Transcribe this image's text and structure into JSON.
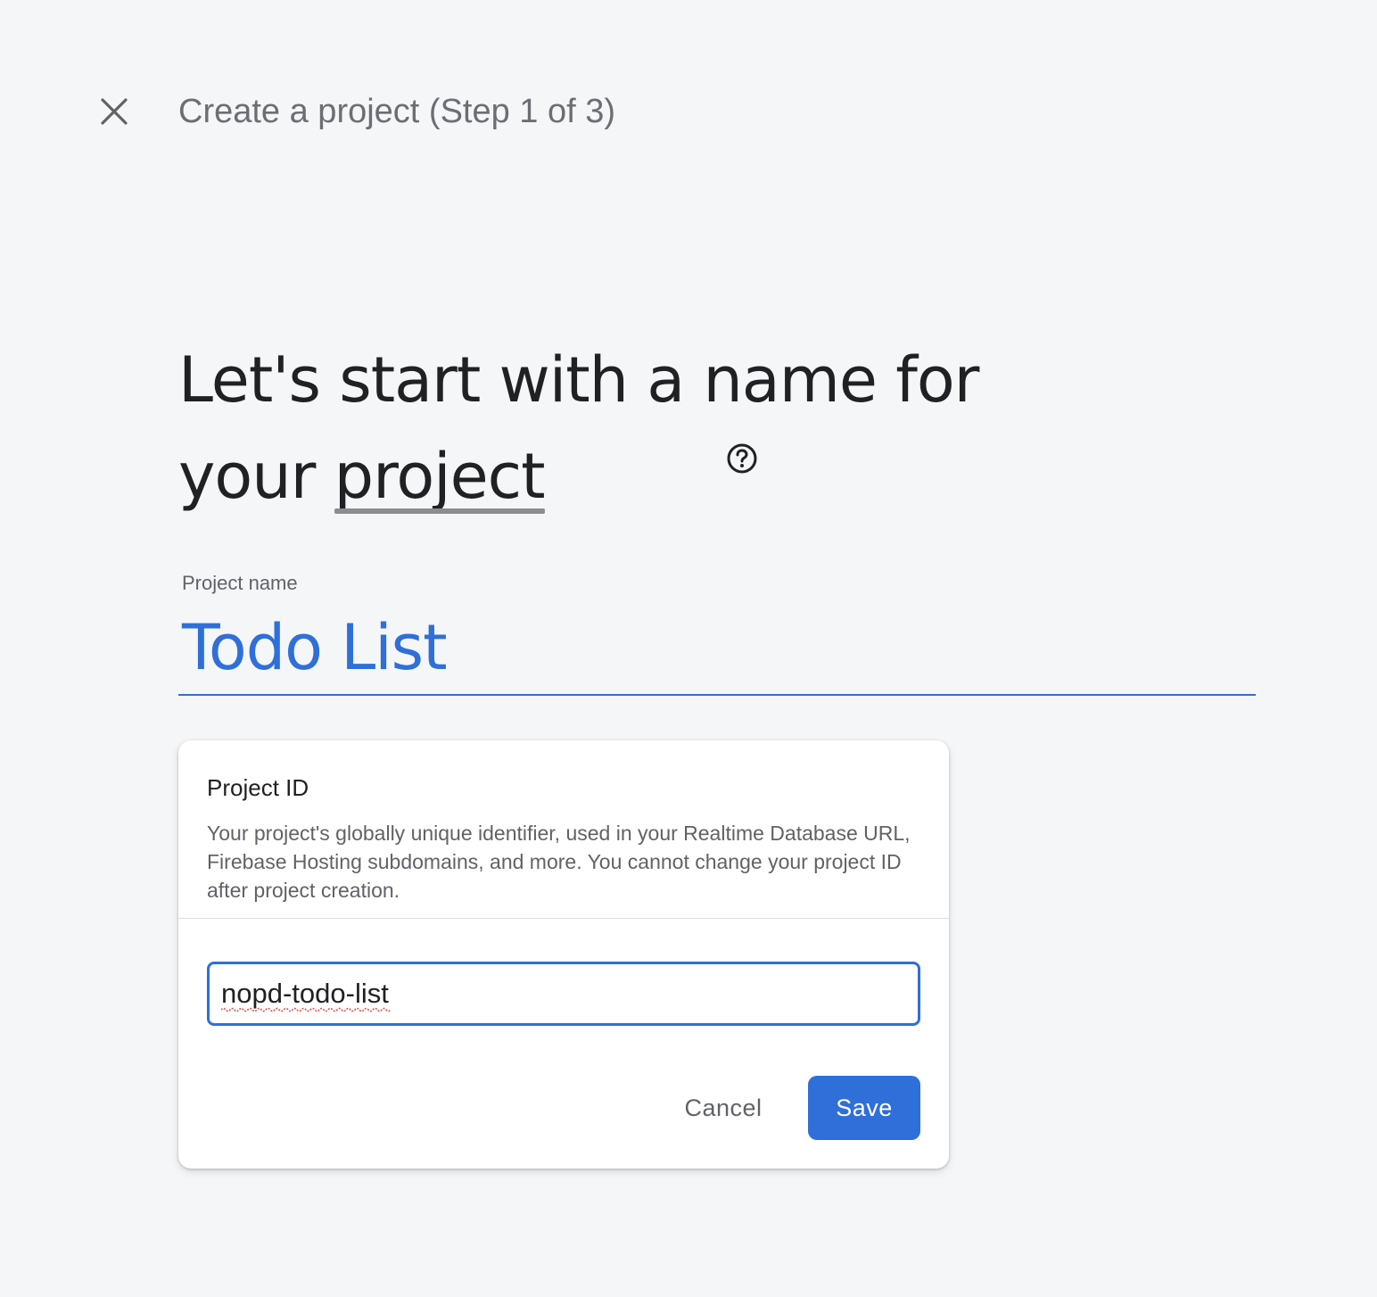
{
  "header": {
    "close_icon": "close-icon",
    "step_title": "Create a project (Step 1 of 3)"
  },
  "main": {
    "headline_part1": "Let's start with a name for your ",
    "headline_term": "project",
    "help_icon": "help-circle-icon",
    "project_name_label": "Project name",
    "project_name_value": "Todo List"
  },
  "project_id_card": {
    "title": "Project ID",
    "description": "Your project's globally unique identifier, used in your Realtime Database URL, Firebase Hosting subdomains, and more. You cannot change your project ID after project creation.",
    "input_value": "nopd-todo-list",
    "cancel_label": "Cancel",
    "save_label": "Save"
  },
  "colors": {
    "accent": "#2f6fd9",
    "background": "#f5f6f8",
    "card": "#ffffff",
    "spellcheck": "#e0504a"
  }
}
